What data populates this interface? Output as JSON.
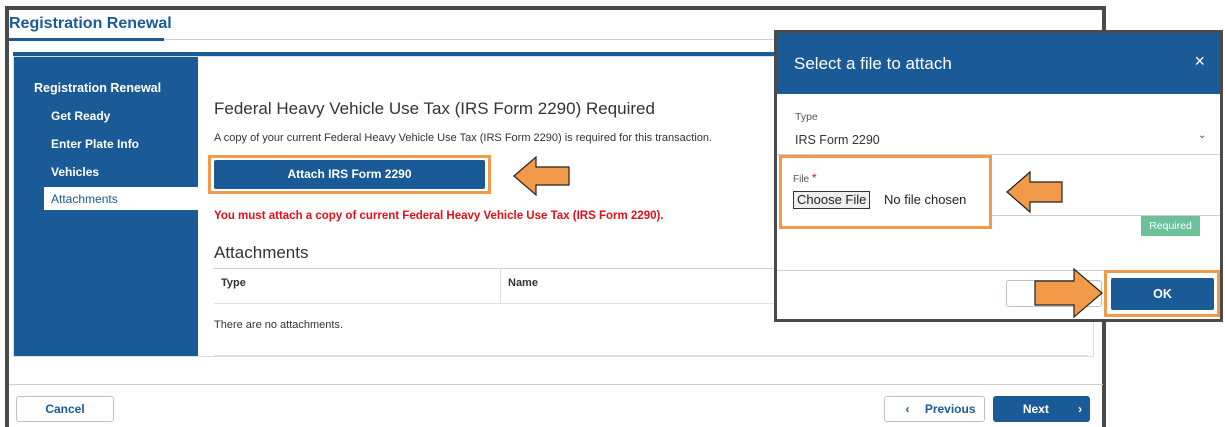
{
  "page": {
    "title": "Registration Renewal"
  },
  "sidebar": {
    "title": "Registration Renewal",
    "items": [
      {
        "label": "Get Ready"
      },
      {
        "label": "Enter Plate Info"
      },
      {
        "label": "Vehicles"
      },
      {
        "label": "Attachments",
        "active": true
      }
    ]
  },
  "main": {
    "heading": "Federal Heavy Vehicle Use Tax (IRS Form 2290) Required",
    "description": "A copy of your current Federal Heavy Vehicle Use Tax (IRS Form 2290) is required for this transaction.",
    "attach_button": "Attach IRS Form 2290",
    "error": "You must attach a copy of current Federal Heavy Vehicle Use Tax (IRS Form 2290).",
    "attachments": {
      "heading": "Attachments",
      "columns": [
        "Type",
        "Name"
      ],
      "empty_message": "There are no attachments."
    }
  },
  "footer": {
    "cancel": "Cancel",
    "previous": "Previous",
    "next": "Next",
    "prev_icon": "chevron-left-icon",
    "next_icon": "chevron-right-icon"
  },
  "modal": {
    "title": "Select a file to attach",
    "close": "×",
    "type_label": "Type",
    "type_value": "IRS Form 2290",
    "file_label": "File",
    "required_star": "*",
    "choose_button": "Choose File",
    "no_file": "No file chosen",
    "required_badge": "Required",
    "ok": "OK"
  },
  "colors": {
    "primary": "#1a5a96",
    "highlight": "#f29a4a",
    "error": "#e0101a",
    "badge": "#6cc09a"
  }
}
